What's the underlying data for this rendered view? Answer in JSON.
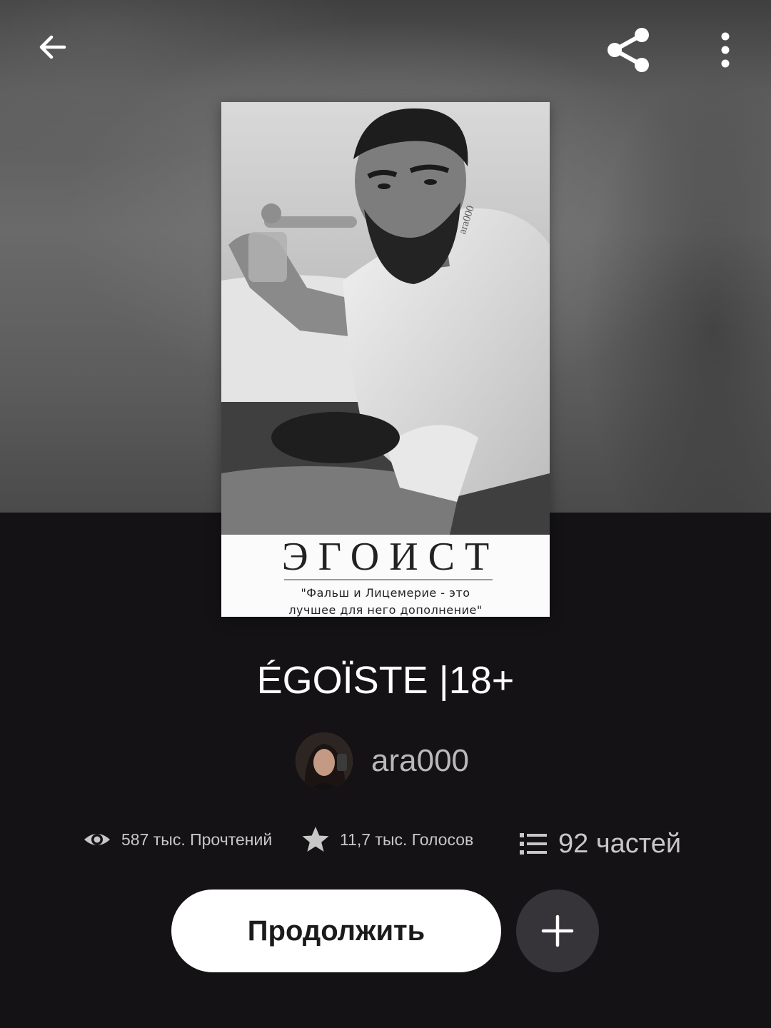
{
  "topbar": {
    "back_icon": "arrow-left-icon",
    "share_icon": "share-icon",
    "more_icon": "more-vertical-icon"
  },
  "cover": {
    "title": "ЭГОИСТ",
    "tagline_line1": "\"Фальш и Лицемерие - это",
    "tagline_line2": "лучшее для него дополнение\"",
    "watermark": "ara000"
  },
  "story": {
    "title": "ÉGOÏSTE |18+",
    "author": "ara000"
  },
  "stats": {
    "reads": "587 тыс. Прочтений",
    "votes": "11,7 тыс. Голосов",
    "parts": "92 частей"
  },
  "actions": {
    "continue_label": "Продолжить",
    "add_icon": "plus-icon"
  },
  "colors": {
    "background": "#141215",
    "primary_button": "#ffffff",
    "secondary_button": "#363438",
    "stat_text": "#c7c7c7"
  }
}
